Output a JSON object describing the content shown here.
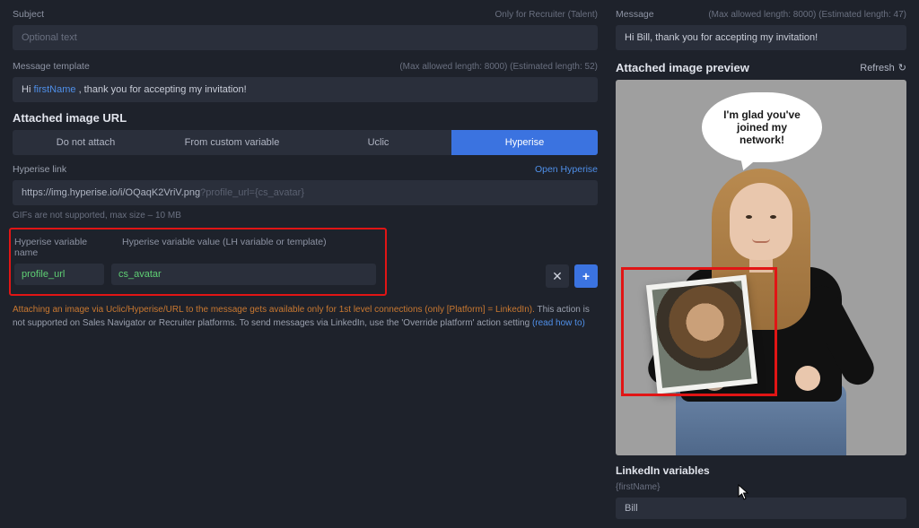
{
  "subject": {
    "label": "Subject",
    "hint": "Only for Recruiter (Talent)",
    "placeholder": "Optional text"
  },
  "messageTemplate": {
    "label": "Message template",
    "hint": "(Max allowed length: 8000) (Estimated length: 52)",
    "prefix": "Hi ",
    "token": "firstName",
    "suffix": " , thank you for accepting my invitation!"
  },
  "attachedImageUrl": {
    "title": "Attached image URL",
    "tabs": [
      "Do not attach",
      "From custom variable",
      "Uclic",
      "Hyperise"
    ],
    "activeTab": 3
  },
  "hyperiseLink": {
    "label": "Hyperise link",
    "openLabel": "Open Hyperise",
    "urlBase": "https://img.hyperise.io/i/OQaqK2VriV.png",
    "urlSuffix": "?profile_url={cs_avatar}",
    "note": "GIFs are not supported, max size – 10 MB"
  },
  "hyperiseVars": {
    "nameHeader": "Hyperise variable name",
    "valueHeader": "Hyperise variable value (LH variable or template)",
    "rows": [
      {
        "name": "profile_url",
        "value": "cs_avatar"
      }
    ]
  },
  "warning": {
    "orange": "Attaching an image via Uclic/Hyperise/URL to the message gets available only for 1st level connections (only [Platform] = LinkedIn).",
    "rest": " This action is not supported on Sales Navigator or Recruiter platforms. To send messages via LinkedIn, use the 'Override platform' action setting ",
    "link": "(read how to)"
  },
  "rightMessage": {
    "label": "Message",
    "hint": "(Max allowed length: 8000) (Estimated length: 47)",
    "value": "Hi Bill, thank you for accepting my invitation!"
  },
  "preview": {
    "title": "Attached image preview",
    "refresh": "Refresh",
    "bubble": "I'm glad you've joined my network!"
  },
  "linkedin": {
    "title": "LinkedIn variables",
    "varLabel": "{firstName}",
    "value": "Bill"
  }
}
